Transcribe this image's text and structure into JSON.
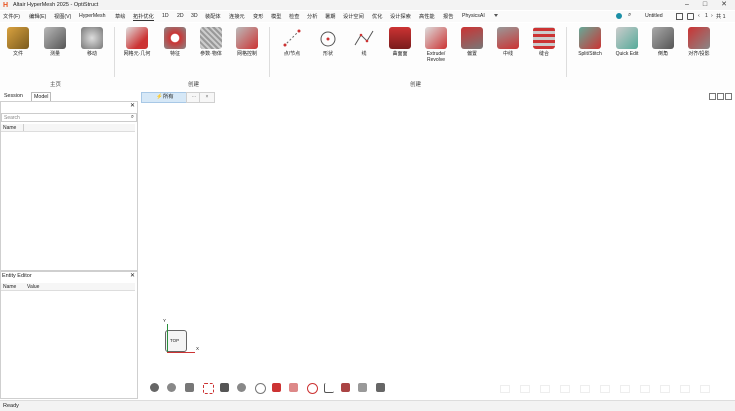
{
  "window": {
    "title": "Altair HyperMesh 2025 - OptiStruct",
    "logo": "H"
  },
  "menubar": {
    "items": [
      "文件(F)",
      "编辑(E)",
      "视图(V)",
      "HyperMesh",
      "草绘",
      "拓扑优化",
      "1D",
      "2D",
      "3D",
      "装配体",
      "连接元",
      "变形",
      "模型",
      "检查",
      "分析",
      "暑期",
      "设计空间",
      "优化",
      "设计探索",
      "高性能",
      "报告",
      "PhysicsAI"
    ],
    "active": "拓扑优化",
    "document_label": "Untitled",
    "page_label": "1",
    "page_total": "共 1"
  },
  "ribbon": {
    "group1": {
      "name": "主页",
      "tools": [
        "文件",
        "测量",
        "移动"
      ]
    },
    "group2": {
      "name": "创建",
      "tools": [
        "网格元·几何",
        "特征",
        "参数·物体",
        "网格控制"
      ]
    },
    "group3": {
      "name": "创建",
      "tools": [
        "点/节点",
        "形状",
        "线",
        "曲面面",
        "Extrude/\nRevolve",
        "偏置",
        "中线",
        "缝合"
      ]
    },
    "group4": {
      "tools": [
        "Split/Stitch",
        "Quick Edit",
        "倒角",
        "对齐/投影"
      ]
    }
  },
  "left_panel": {
    "tabs": [
      "Session",
      "Model"
    ],
    "search_placeholder": "Search",
    "column_name": "Name"
  },
  "entity_editor": {
    "title": "Entity Editor",
    "col_name": "Name",
    "col_value": "Value"
  },
  "viewport": {
    "filter_label": "所有",
    "view_label": "TOP",
    "axis_x": "X",
    "axis_y": "Y"
  },
  "status": {
    "text": "Ready"
  }
}
